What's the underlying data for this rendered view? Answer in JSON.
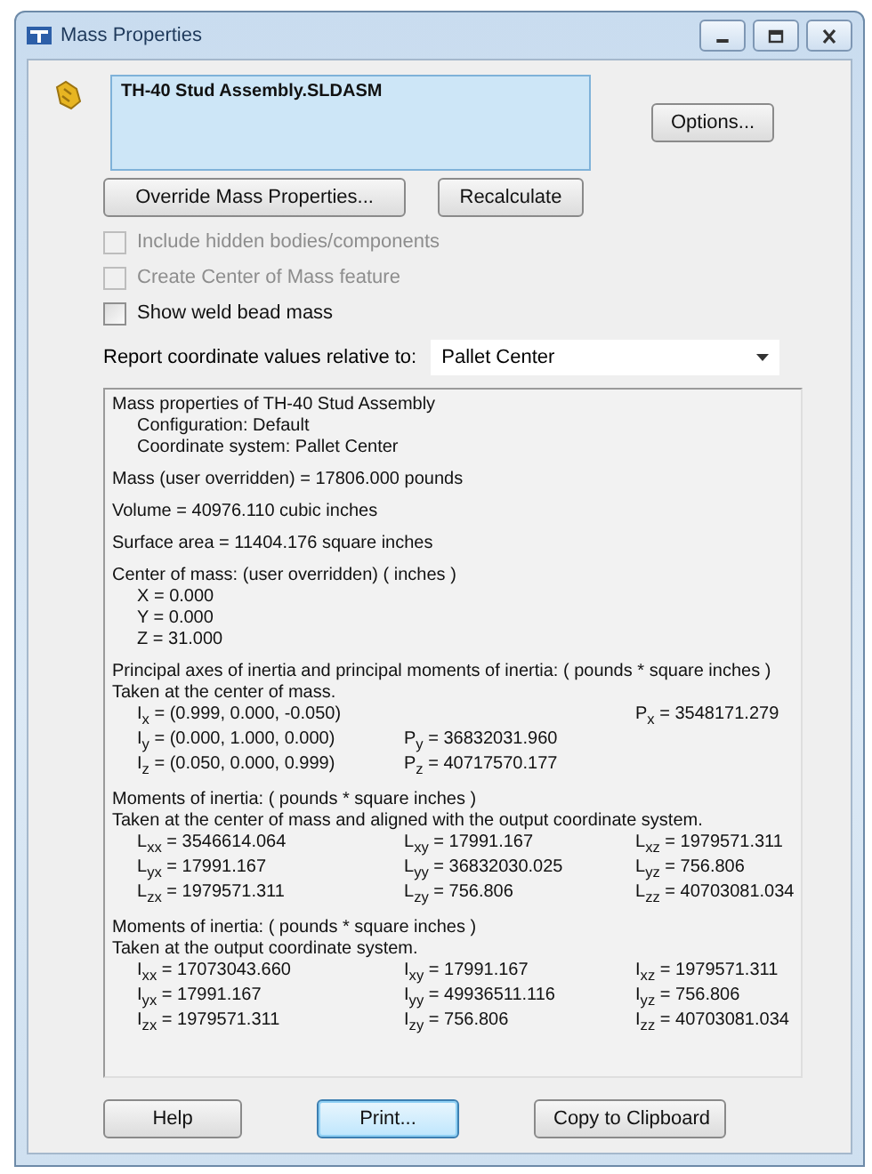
{
  "window": {
    "title": "Mass Properties",
    "controls": [
      {
        "kind": "minimize"
      },
      {
        "kind": "maximize"
      },
      {
        "kind": "close"
      }
    ]
  },
  "selection": {
    "value": "TH-40 Stud Assembly.SLDASM"
  },
  "options_button": "Options...",
  "override_button": "Override Mass Properties...",
  "recalculate_button": "Recalculate",
  "checkboxes": [
    {
      "label": "Include hidden bodies/components",
      "checked": false,
      "disabled": true
    },
    {
      "label": "Create Center of Mass feature",
      "checked": false,
      "disabled": true
    },
    {
      "label": "Show weld bead mass",
      "checked": false,
      "disabled": false
    }
  ],
  "coordinate": {
    "label": "Report coordinate values relative to:",
    "value": "Pallet Center"
  },
  "results": [
    {
      "kind": "heading",
      "text": "Mass properties of TH-40 Stud Assembly"
    },
    {
      "kind": "detail",
      "text": "Configuration: Default"
    },
    {
      "kind": "detail",
      "text": "Coordinate system: Pallet Center"
    },
    {
      "kind": "gap"
    },
    {
      "kind": "heading",
      "text": "Mass (user overridden) = 17806.000 pounds"
    },
    {
      "kind": "gap"
    },
    {
      "kind": "heading",
      "text": "Volume = 40976.110 cubic inches"
    },
    {
      "kind": "gap"
    },
    {
      "kind": "heading",
      "text": "Surface area = 11404.176 square inches"
    },
    {
      "kind": "gap"
    },
    {
      "kind": "heading",
      "text": "Center of mass: (user overridden) ( inches )"
    },
    {
      "kind": "detail",
      "text": "X = 0.000"
    },
    {
      "kind": "detail",
      "text": "Y = 0.000"
    },
    {
      "kind": "detail",
      "text": "Z = 31.000"
    },
    {
      "kind": "gap"
    },
    {
      "kind": "heading",
      "text": "Principal axes of inertia and principal moments of inertia: ( pounds * square inches )"
    },
    {
      "kind": "heading",
      "text": "Taken at the center of mass."
    },
    {
      "kind": "cells",
      "cells": [
        "I$_{x}$ = (0.999, 0.000, -0.050)",
        "",
        "P$_{x}$ = 3548171.279"
      ]
    },
    {
      "kind": "cells",
      "cells": [
        "I$_{y}$ = (0.000, 1.000, 0.000)",
        "P$_{y}$ = 36832031.960",
        ""
      ]
    },
    {
      "kind": "cells",
      "cells": [
        "I$_{z}$ = (0.050, 0.000, 0.999)",
        "P$_{z}$ = 40717570.177",
        ""
      ]
    },
    {
      "kind": "gap"
    },
    {
      "kind": "heading",
      "text": "Moments of inertia: ( pounds * square inches )"
    },
    {
      "kind": "heading",
      "text": "Taken at the center of mass and aligned with the output coordinate system."
    },
    {
      "kind": "cells",
      "cells": [
        "L$_{xx}$ = 3546614.064",
        "L$_{xy}$ = 17991.167",
        "L$_{xz}$ = 1979571.311"
      ]
    },
    {
      "kind": "cells",
      "cells": [
        "L$_{yx}$ = 17991.167",
        "L$_{yy}$ = 36832030.025",
        "L$_{yz}$ = 756.806"
      ]
    },
    {
      "kind": "cells",
      "cells": [
        "L$_{zx}$ = 1979571.311",
        "L$_{zy}$ = 756.806",
        "L$_{zz}$ = 40703081.034"
      ]
    },
    {
      "kind": "gap"
    },
    {
      "kind": "heading",
      "text": "Moments of inertia: ( pounds * square inches )"
    },
    {
      "kind": "heading",
      "text": "Taken at the output coordinate system."
    },
    {
      "kind": "cells",
      "cells": [
        "I$_{xx}$ = 17073043.660",
        "I$_{xy}$ = 17991.167",
        "I$_{xz}$ = 1979571.311"
      ]
    },
    {
      "kind": "cells",
      "cells": [
        "I$_{yx}$ = 17991.167",
        "I$_{yy}$ = 49936511.116",
        "I$_{yz}$ = 756.806"
      ]
    },
    {
      "kind": "cells",
      "cells": [
        "I$_{zx}$ = 1979571.311",
        "I$_{zy}$ = 756.806",
        "I$_{zz}$ = 40703081.034"
      ]
    }
  ],
  "buttons": [
    {
      "label": "Help",
      "focused": false
    },
    {
      "label": "Print...",
      "focused": true
    },
    {
      "label": "Copy to Clipboard",
      "focused": false
    }
  ]
}
